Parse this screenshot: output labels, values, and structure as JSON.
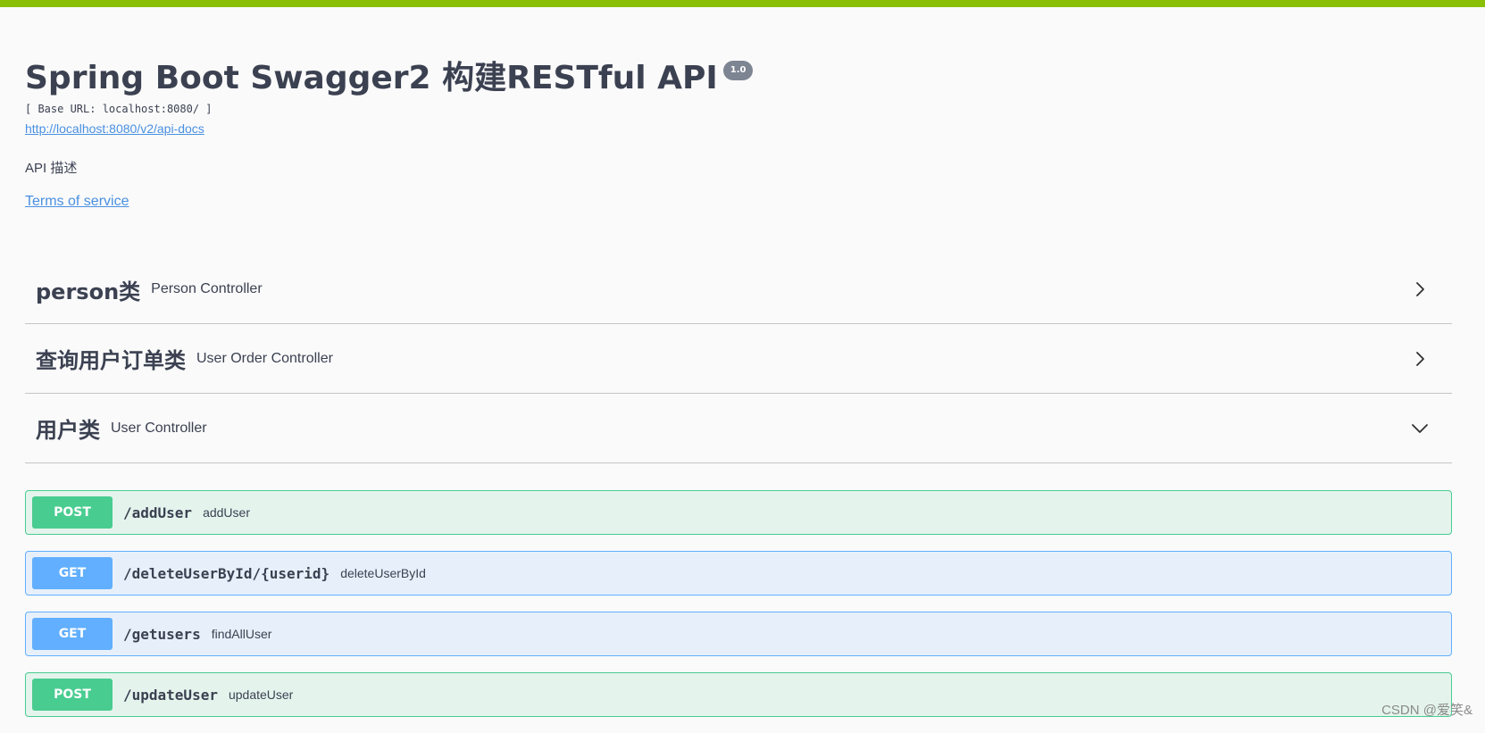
{
  "info": {
    "title": "Spring Boot Swagger2 构建RESTful API",
    "version": "1.0",
    "base_url": "[ Base URL: localhost:8080/ ]",
    "docs_link": "http://localhost:8080/v2/api-docs",
    "description": "API 描述",
    "terms_of_service": "Terms of service"
  },
  "tags": [
    {
      "name": "person类",
      "description": "Person Controller",
      "state": "collapsed",
      "icon": "chevron-right-icon"
    },
    {
      "name": "查询用户订单类",
      "description": "User Order Controller",
      "state": "collapsed",
      "icon": "chevron-right-icon"
    },
    {
      "name": "用户类",
      "description": "User Controller",
      "state": "expanded",
      "icon": "chevron-down-icon"
    }
  ],
  "operations": [
    {
      "method": "POST",
      "path": "/addUser",
      "summary": "addUser"
    },
    {
      "method": "GET",
      "path": "/deleteUserById/{userid}",
      "summary": "deleteUserById"
    },
    {
      "method": "GET",
      "path": "/getusers",
      "summary": "findAllUser"
    },
    {
      "method": "POST",
      "path": "/updateUser",
      "summary": "updateUser"
    }
  ],
  "watermark": "CSDN @爱笑&",
  "colors": {
    "top_bar": "#89bf04",
    "post": "#49cc90",
    "get": "#61affe",
    "link": "#4990e2",
    "text": "#3b4151"
  }
}
